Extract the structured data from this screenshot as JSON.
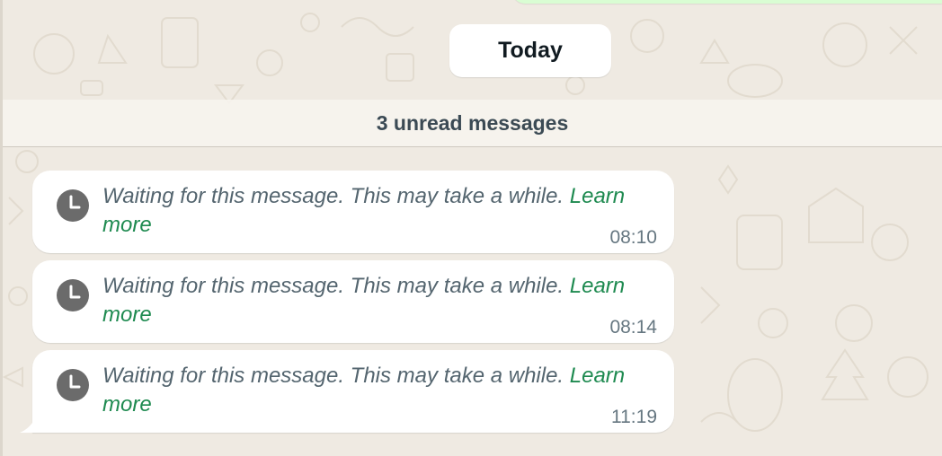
{
  "date_separator": {
    "label": "Today"
  },
  "unread_banner": {
    "label": "3 unread messages"
  },
  "messages": [
    {
      "icon": "clock-icon",
      "text": "Waiting for this message. This may take a while.",
      "link_label": "Learn more",
      "time": "08:10"
    },
    {
      "icon": "clock-icon",
      "text": "Waiting for this message. This may take a while.",
      "link_label": "Learn more",
      "time": "08:14"
    },
    {
      "icon": "clock-icon",
      "text": "Waiting for this message. This may take a while.",
      "link_label": "Learn more",
      "time": "11:19"
    }
  ],
  "colors": {
    "wallpaper": "#efeae2",
    "bubble": "#ffffff",
    "link": "#1e8a50",
    "message_text": "#54656f",
    "time": "#667781",
    "clock_icon": "#6b6b6b"
  }
}
